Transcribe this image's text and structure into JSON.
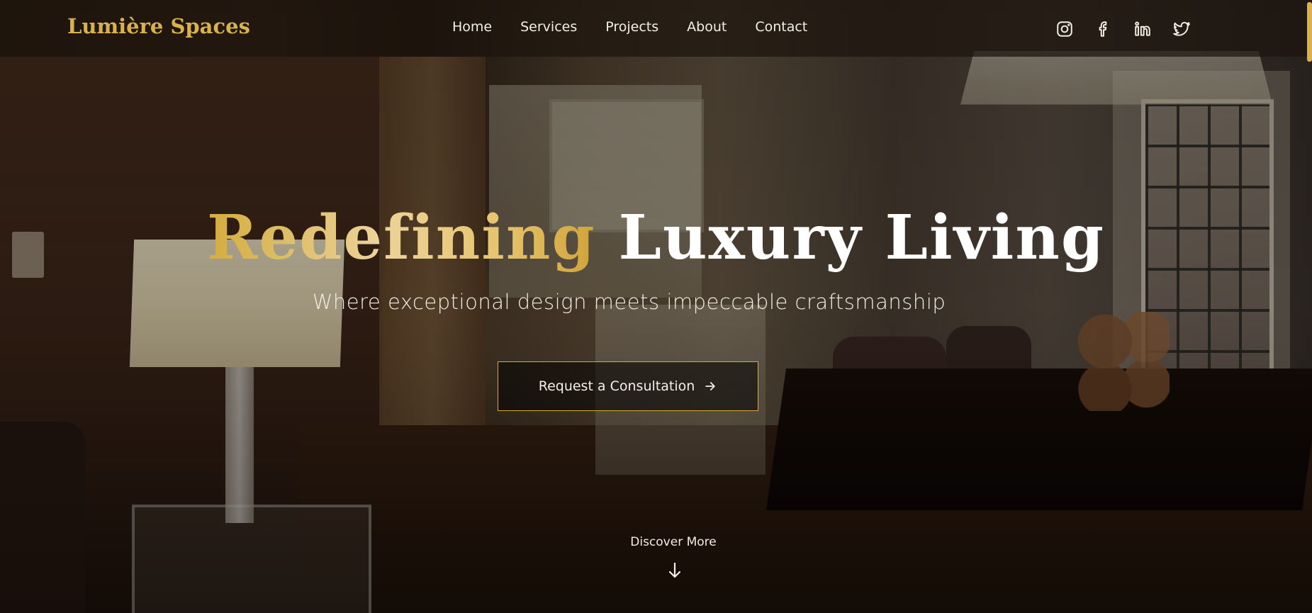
{
  "brand": {
    "name": "Lumière Spaces",
    "color": "#d9b24f"
  },
  "nav": {
    "links": [
      {
        "label": "Home"
      },
      {
        "label": "Services"
      },
      {
        "label": "Projects"
      },
      {
        "label": "About"
      },
      {
        "label": "Contact"
      }
    ]
  },
  "social": [
    {
      "icon": "instagram-icon"
    },
    {
      "icon": "facebook-icon"
    },
    {
      "icon": "linkedin-icon"
    },
    {
      "icon": "twitter-icon"
    }
  ],
  "hero": {
    "headline_gold": "Redefining",
    "headline_white": "Luxury Living",
    "tagline": "Where exceptional design meets impeccable craftsmanship",
    "cta_label": "Request a Consultation",
    "cta_icon": "arrow-right-icon",
    "discover_label": "Discover More",
    "discover_icon": "arrow-down-icon",
    "background": "luxury-interior-photo"
  },
  "colors": {
    "accent": "#d4ac3e",
    "text": "#f4efe6"
  }
}
